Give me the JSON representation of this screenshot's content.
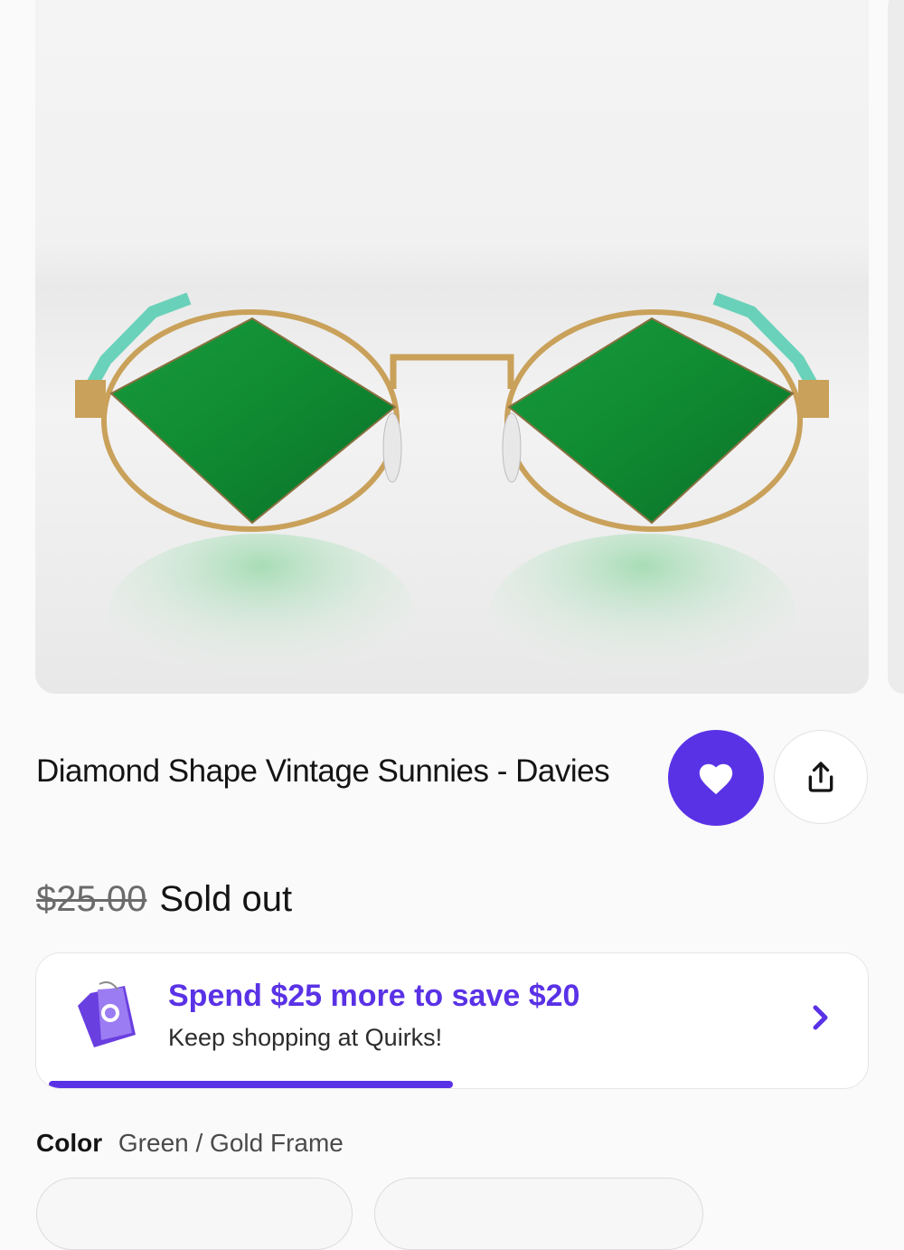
{
  "product": {
    "title": "Diamond Shape Vintage Sunnies - Davies",
    "old_price": "$25.00",
    "status": "Sold out",
    "image_icon": "sunglasses-product-image",
    "favorite_icon": "heart-icon",
    "share_icon": "share-icon"
  },
  "promo": {
    "headline": "Spend $25 more to save $20",
    "subtext": "Keep shopping at Quirks!",
    "progress": 0.5,
    "icon": "price-tag-icon",
    "chevron_icon": "chevron-right-icon"
  },
  "color": {
    "label": "Color",
    "value": "Green / Gold Frame"
  },
  "colors": {
    "accent": "#5a32e6",
    "lens": "#1f8f3a",
    "frame": "#c9a15a"
  }
}
